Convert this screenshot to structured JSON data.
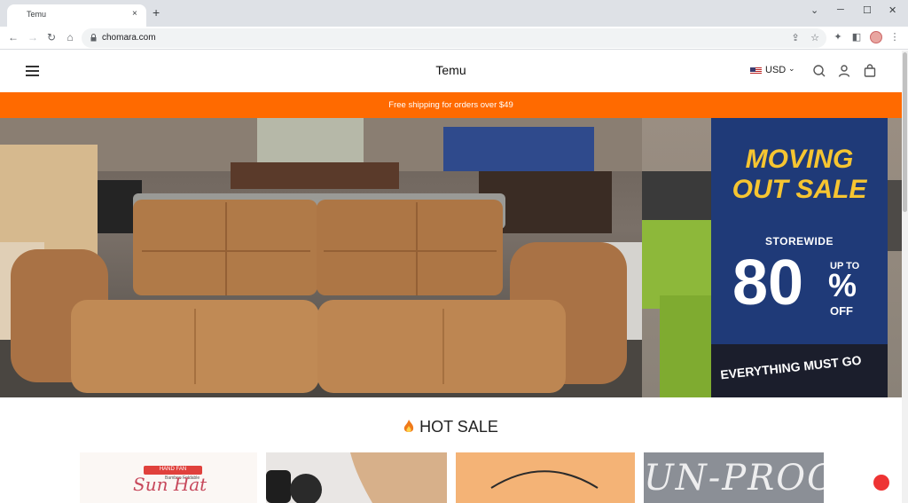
{
  "browser": {
    "tab_title": "Temu",
    "tab_close": "×",
    "new_tab": "+",
    "url": "chomara.com",
    "window_controls": {
      "minimize": "─",
      "maximize": "☐",
      "close": "✕",
      "tab_search": "⌄"
    }
  },
  "site": {
    "logo": "Temu",
    "currency": "USD",
    "shipping_banner": "Free shipping for orders over $49"
  },
  "hero": {
    "banner_title_line1": "MOVING",
    "banner_title_line2": "OUT SALE",
    "banner_sub": "STOREWIDE",
    "banner_percent": "80",
    "banner_up_to": "UP TO",
    "banner_pct_sign": "%",
    "banner_off": "OFF",
    "banner_footer": "EVERYTHING MUST GO"
  },
  "hot_sale": {
    "title": "HOT SALE",
    "products": [
      {
        "badge": "HAND FAN",
        "script": "Sun Hat",
        "small": "Bamboo Foldable"
      },
      {
        "name": ""
      },
      {
        "name": ""
      },
      {
        "overlay_text": "UN-PROO"
      }
    ]
  },
  "colors": {
    "accent": "#ff6a00",
    "banner_blue": "#1f3a78",
    "banner_yellow": "#f6c531"
  }
}
